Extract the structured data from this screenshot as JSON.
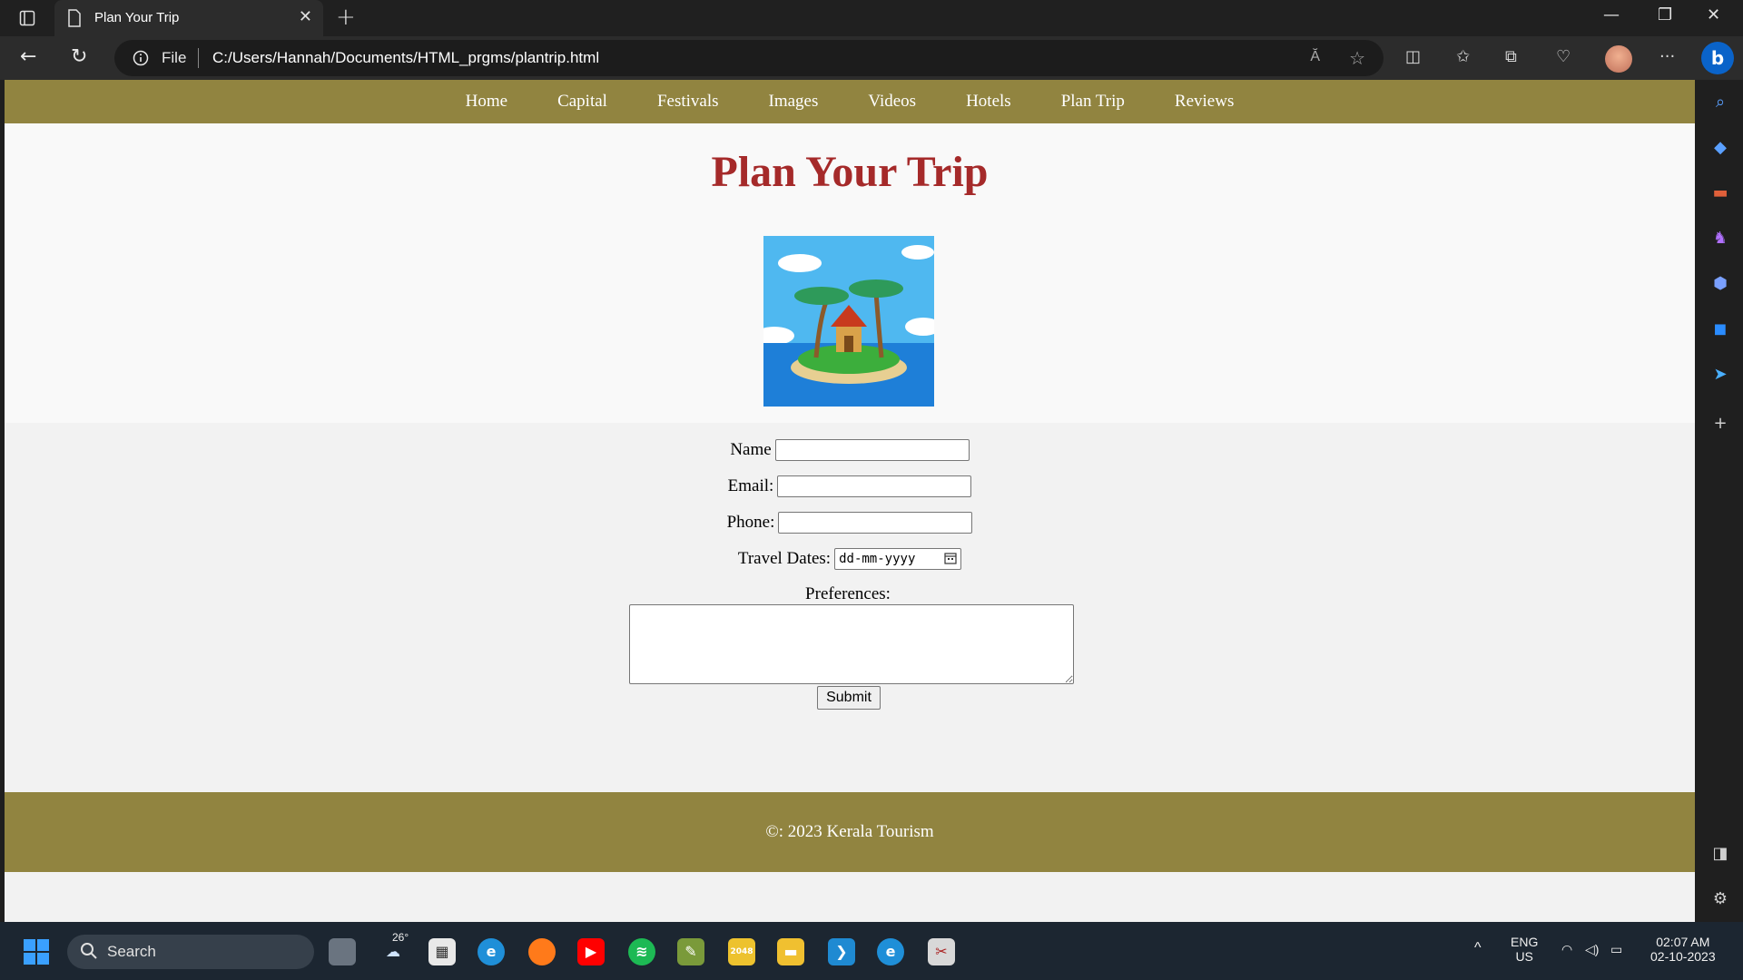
{
  "browser": {
    "tab_title": "Plan Your Trip",
    "address_label": "File",
    "url": "C:/Users/Hannah/Documents/HTML_prgms/plantrip.html",
    "read_aloud": "Ă"
  },
  "site": {
    "nav": [
      "Home",
      "Capital",
      "Festivals",
      "Images",
      "Videos",
      "Hotels",
      "Plan Trip",
      "Reviews"
    ],
    "heading": "Plan Your Trip",
    "form": {
      "name_label": "Name",
      "email_label": "Email:",
      "phone_label": "Phone:",
      "dates_label": "Travel Dates:",
      "date_placeholder": "dd-mm-yyyy",
      "preferences_label": "Preferences:",
      "submit_label": "Submit"
    },
    "footer": "©: 2023 Kerala Tourism"
  },
  "taskbar": {
    "search_placeholder": "Search",
    "weather_temp": "26°",
    "lang_top": "ENG",
    "lang_bottom": "US",
    "time": "02:07 AM",
    "date": "02-10-2023",
    "game_tile": "2048"
  },
  "colors": {
    "nav_bg": "#918440",
    "heading": "#a52a2a",
    "footer_bg": "#918440"
  }
}
